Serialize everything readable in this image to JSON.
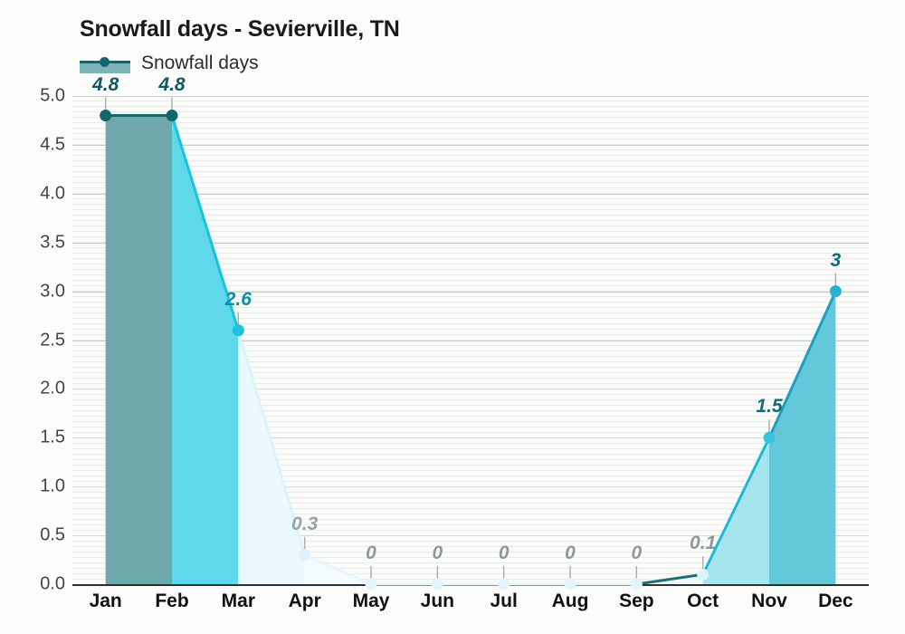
{
  "chart_data": {
    "type": "area",
    "title": "Snowfall days - Sevierville, TN",
    "xlabel": "",
    "ylabel": "",
    "categories": [
      "Jan",
      "Feb",
      "Mar",
      "Apr",
      "May",
      "Jun",
      "Jul",
      "Aug",
      "Sep",
      "Oct",
      "Nov",
      "Dec"
    ],
    "values": [
      4.8,
      4.8,
      2.6,
      0.3,
      0,
      0,
      0,
      0,
      0,
      0.1,
      1.5,
      3
    ],
    "point_labels": [
      "4.8",
      "4.8",
      "2.6",
      "0.3",
      "0",
      "0",
      "0",
      "0",
      "0",
      "0.1",
      "1.5",
      "3"
    ],
    "ylim": [
      0.0,
      5.0
    ],
    "ytick_labels": [
      "0.0",
      "0.5",
      "1.0",
      "1.5",
      "2.0",
      "2.5",
      "3.0",
      "3.5",
      "4.0",
      "4.5",
      "5.0"
    ],
    "ytick_values": [
      0.0,
      0.5,
      1.0,
      1.5,
      2.0,
      2.5,
      3.0,
      3.5,
      4.0,
      4.5,
      5.0
    ],
    "grid": true,
    "legend": [
      {
        "name": "Snowfall days",
        "line_color": "#14666d",
        "fill_color": "#7fb4b7"
      }
    ],
    "legend_position": "top-left",
    "segment_colors": [
      "#6fa8ab",
      "#5fd8ea",
      "#eaf9fd",
      "#f3fbfe",
      "#f3fbfe",
      "#f3fbfe",
      "#f3fbfe",
      "#f3fbfe",
      "#eef9fd",
      "#a5e3ee",
      "#63c9da"
    ],
    "line_colors": [
      "#15666e",
      "#18c3dd",
      "#ddf3fb",
      "#e8f6fc",
      "#e8f6fc",
      "#e8f6fc",
      "#e8f6fc",
      "#e8f6fc",
      "#1b6f75",
      "#22b8d4",
      "#1f9fc0"
    ],
    "marker_colors": [
      "#14666d",
      "#14666d",
      "#1cc4de",
      "#ddf3fb",
      "#e3f5fb",
      "#e3f5fb",
      "#e3f5fb",
      "#e3f5fb",
      "#e3f5fb",
      "#ddf3fb",
      "#31c4dc",
      "#23b4cf"
    ],
    "label_colors": [
      "#0e5a63",
      "#0e5a63",
      "#0d8fa8",
      "#9aa5a8",
      "#8c9a9c",
      "#8c9a9c",
      "#8c9a9c",
      "#8c9a9c",
      "#8c9a9c",
      "#8c9a9c",
      "#0f6d79",
      "#0f6d79"
    ],
    "background": "#fbfcf9",
    "axis_color": "#2f2f2f"
  }
}
